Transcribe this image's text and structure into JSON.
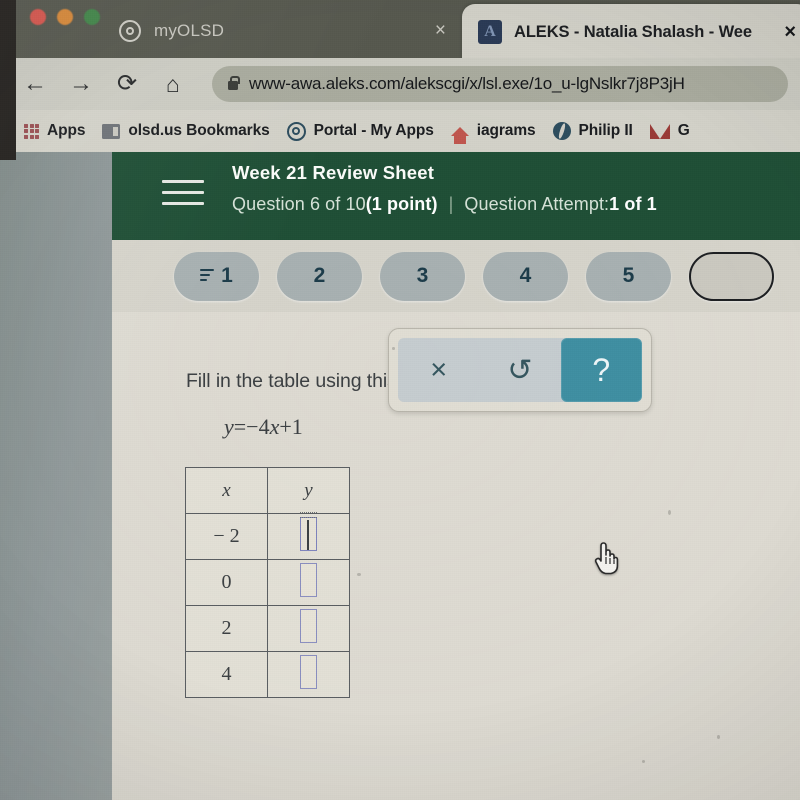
{
  "browser": {
    "window_controls": [
      "close",
      "minimize",
      "maximize"
    ],
    "tabs": [
      {
        "title": "myOLSD",
        "favicon": "target-icon",
        "active": false,
        "close_label": "×"
      },
      {
        "title": "ALEKS - Natalia Shalash - Wee",
        "favicon": "aleks-a-icon",
        "active": true,
        "close_label": "×"
      }
    ],
    "nav": {
      "back": "←",
      "forward": "→",
      "reload": "⟳",
      "home": "⌂"
    },
    "omnibox": {
      "lock_icon": "lock-icon",
      "url": "www-awa.aleks.com/alekscgi/x/lsl.exe/1o_u-lgNslkr7j8P3jH"
    },
    "bookmarks": [
      {
        "label": "Apps",
        "icon": "apps-grid-icon"
      },
      {
        "label": "olsd.us Bookmarks",
        "icon": "folder-icon"
      },
      {
        "label": "Portal - My Apps",
        "icon": "target-icon"
      },
      {
        "label": "iagrams",
        "icon": "house-icon"
      },
      {
        "label": "Philip II",
        "icon": "globe-icon"
      },
      {
        "label": "G",
        "icon": "gmail-icon"
      }
    ]
  },
  "aleks": {
    "menu_icon": "hamburger-menu-icon",
    "assignment_title": "Week 21 Review Sheet",
    "question_progress_prefix": "Question 6 of 10 ",
    "question_points": "(1 point)",
    "separator": "|",
    "attempt_prefix": "Question Attempt: ",
    "attempt_value": "1 of 1",
    "question_pills": [
      {
        "label": "1",
        "has_lines_icon": true,
        "current": false
      },
      {
        "label": "2",
        "has_lines_icon": false,
        "current": false
      },
      {
        "label": "3",
        "has_lines_icon": false,
        "current": false
      },
      {
        "label": "4",
        "has_lines_icon": false,
        "current": false
      },
      {
        "label": "5",
        "has_lines_icon": false,
        "current": false
      },
      {
        "label": "",
        "has_lines_icon": false,
        "current": true
      }
    ],
    "question": {
      "instruction": "Fill in the table using this function rule.",
      "formula_y": "y",
      "formula_eq": "=−4",
      "formula_x": "x",
      "formula_tail": "+1",
      "table": {
        "headers": [
          "x",
          "y"
        ],
        "rows": [
          {
            "x": "− 2",
            "y": "",
            "active": true
          },
          {
            "x": "0",
            "y": "",
            "active": false
          },
          {
            "x": "2",
            "y": "",
            "active": false
          },
          {
            "x": "4",
            "y": "",
            "active": false
          }
        ]
      }
    },
    "math_toolbar": {
      "clear_label": "×",
      "clear_name": "clear-button",
      "undo_label": "↺",
      "undo_name": "undo-button",
      "help_label": "?",
      "help_name": "help-button",
      "help_active": true
    },
    "colors": {
      "header_green": "#1f4f36",
      "pill_fill": "#a8b1b2",
      "help_teal": "#3f8fa2",
      "page_beige": "#dedbd2",
      "answer_box_border": "#8b8fc0"
    }
  }
}
